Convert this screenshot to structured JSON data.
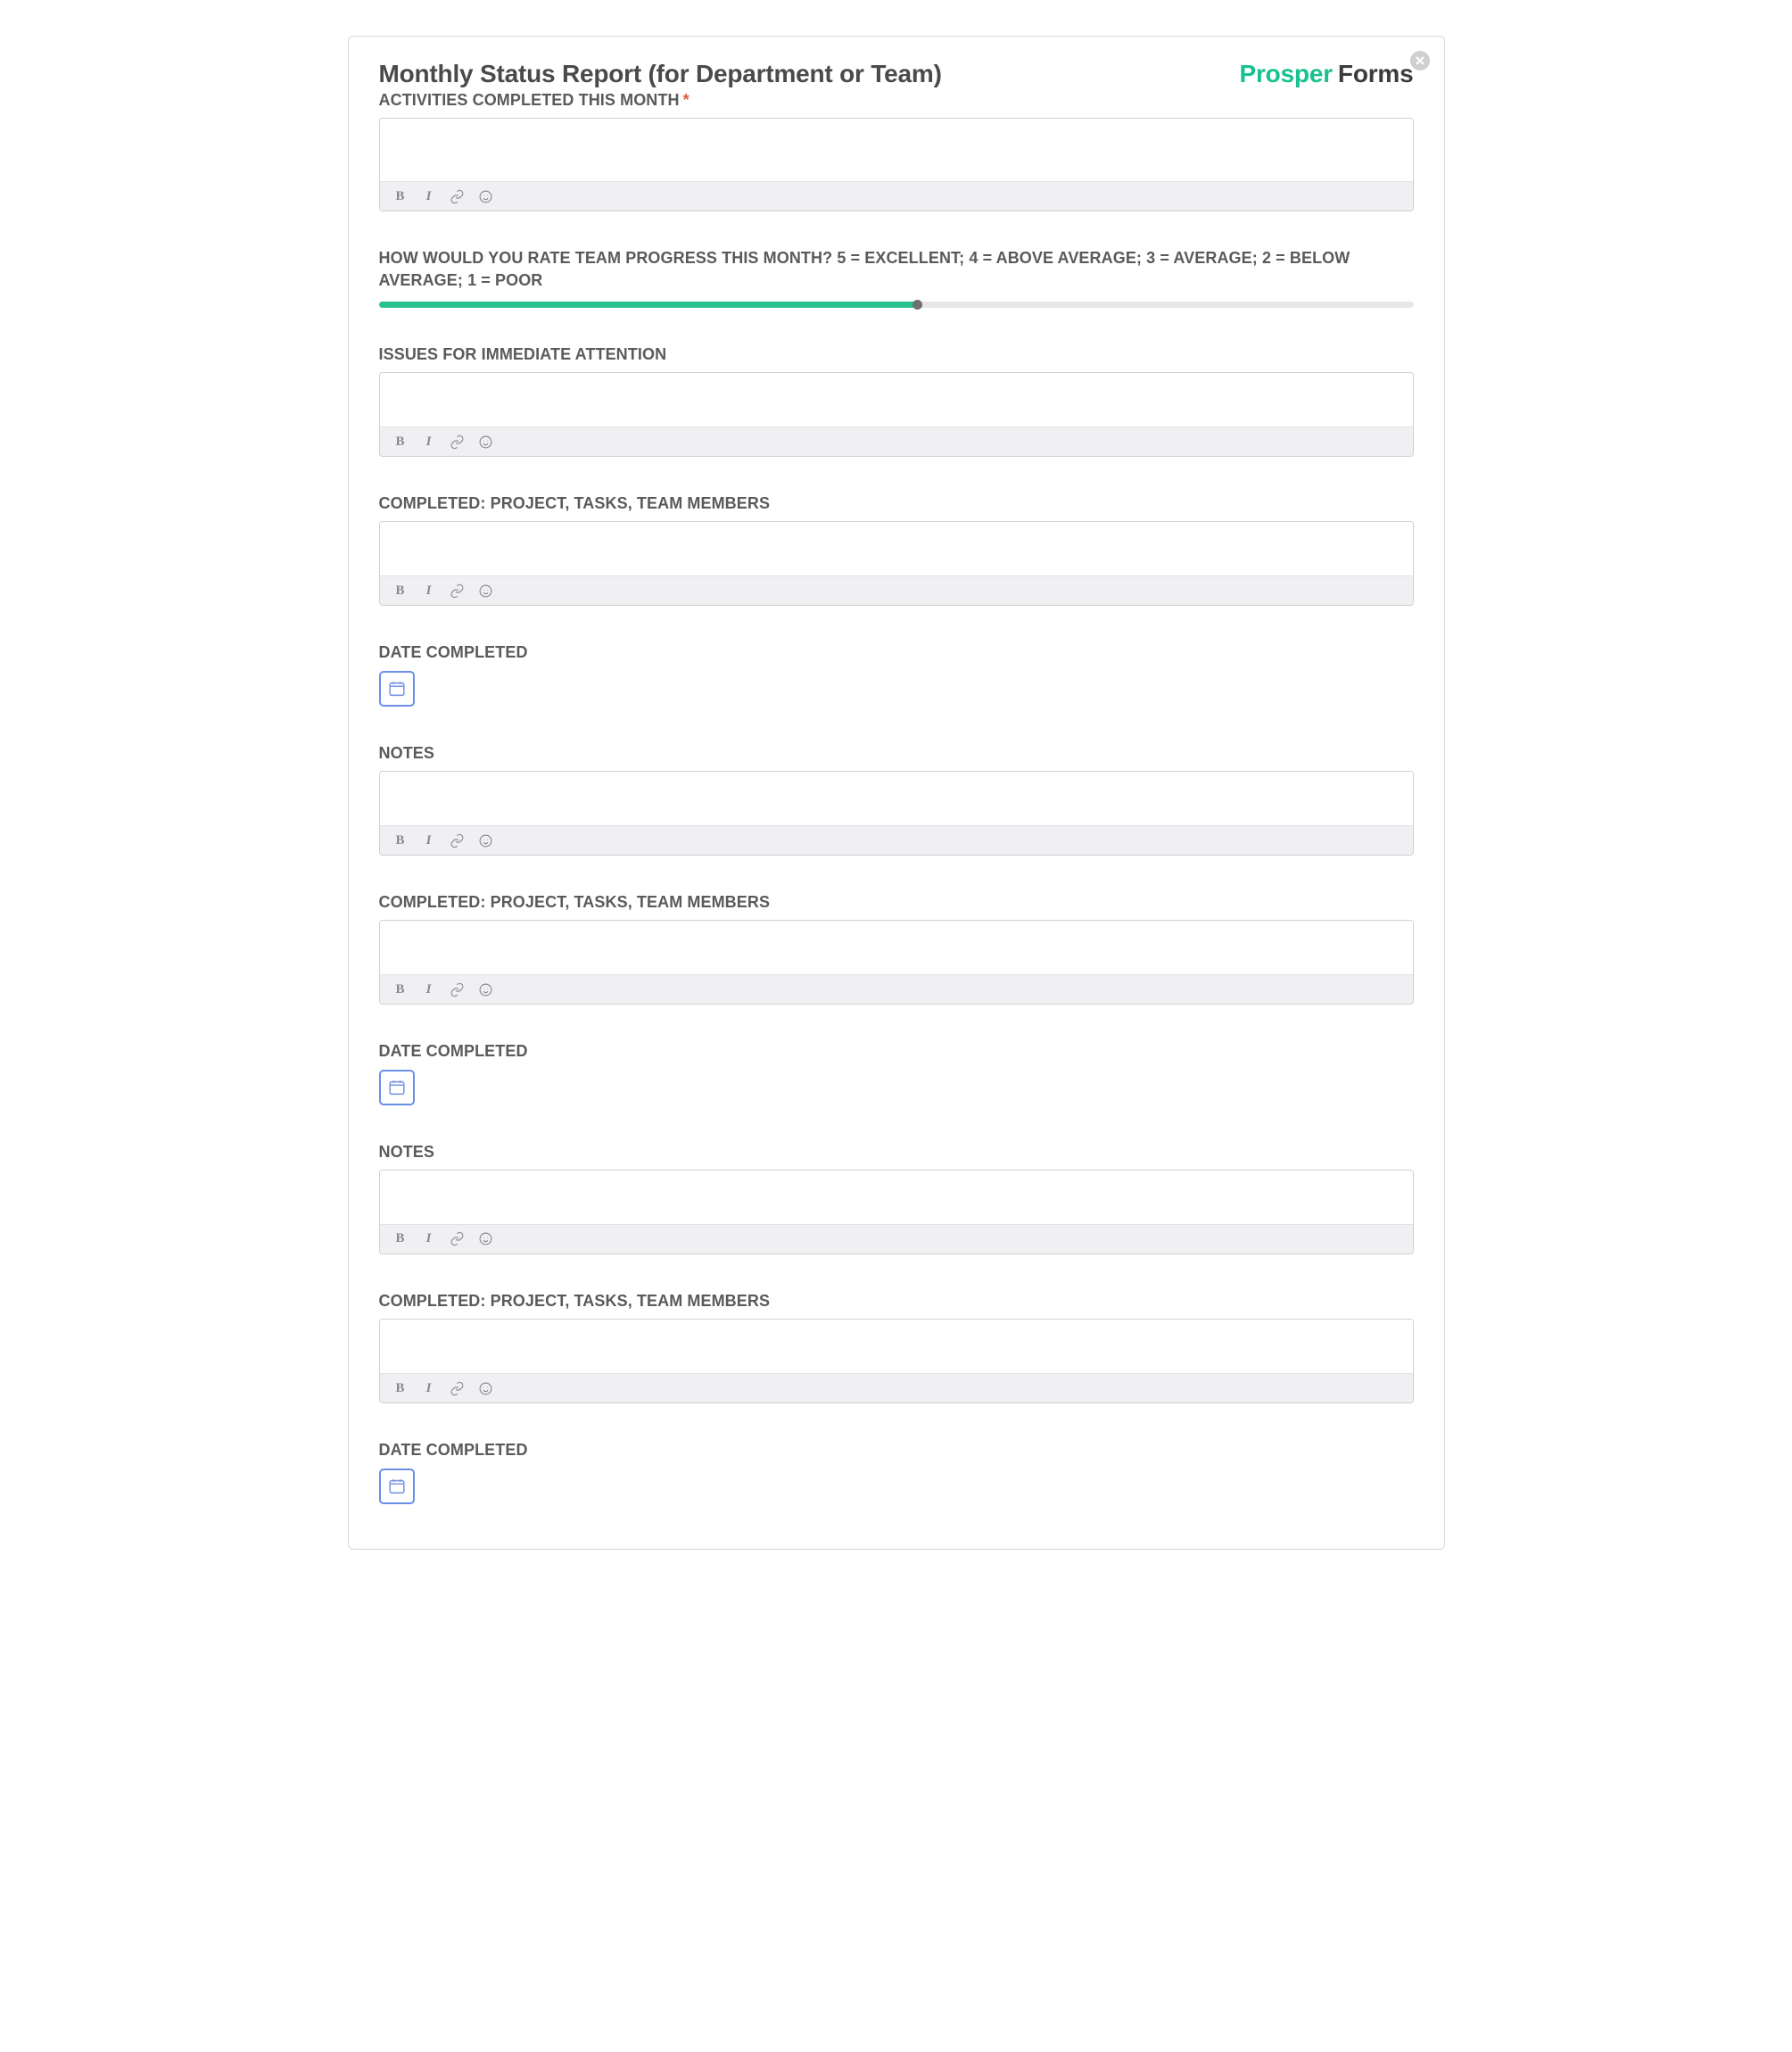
{
  "header": {
    "title": "Monthly Status Report (for Department or Team)",
    "brand_first": "Prosper",
    "brand_second": "Forms"
  },
  "slider": {
    "percent": 52
  },
  "fields": [
    {
      "label": "ACTIVITIES COMPLETED THIS MONTH",
      "required": true,
      "type": "rte",
      "textarea_class": ""
    },
    {
      "label": "HOW WOULD YOU RATE TEAM PROGRESS THIS MONTH? 5 = EXCELLENT; 4 = ABOVE AVERAGE; 3 = AVERAGE; 2 = BELOW AVERAGE; 1 = POOR",
      "required": false,
      "type": "slider"
    },
    {
      "label": "ISSUES FOR IMMEDIATE ATTENTION",
      "required": false,
      "type": "rte",
      "textarea_class": "short"
    },
    {
      "label": "COMPLETED: PROJECT, TASKS, TEAM MEMBERS",
      "required": false,
      "type": "rte",
      "textarea_class": "short"
    },
    {
      "label": "DATE COMPLETED",
      "required": false,
      "type": "date"
    },
    {
      "label": "NOTES",
      "required": false,
      "type": "rte",
      "textarea_class": "short"
    },
    {
      "label": "COMPLETED: PROJECT, TASKS, TEAM MEMBERS",
      "required": false,
      "type": "rte",
      "textarea_class": "short"
    },
    {
      "label": "DATE COMPLETED",
      "required": false,
      "type": "date"
    },
    {
      "label": "NOTES",
      "required": false,
      "type": "rte",
      "textarea_class": "short"
    },
    {
      "label": "COMPLETED: PROJECT, TASKS, TEAM MEMBERS",
      "required": false,
      "type": "rte",
      "textarea_class": "short"
    },
    {
      "label": "DATE COMPLETED",
      "required": false,
      "type": "date"
    }
  ],
  "toolbar": {
    "bold": "B",
    "italic": "I"
  }
}
